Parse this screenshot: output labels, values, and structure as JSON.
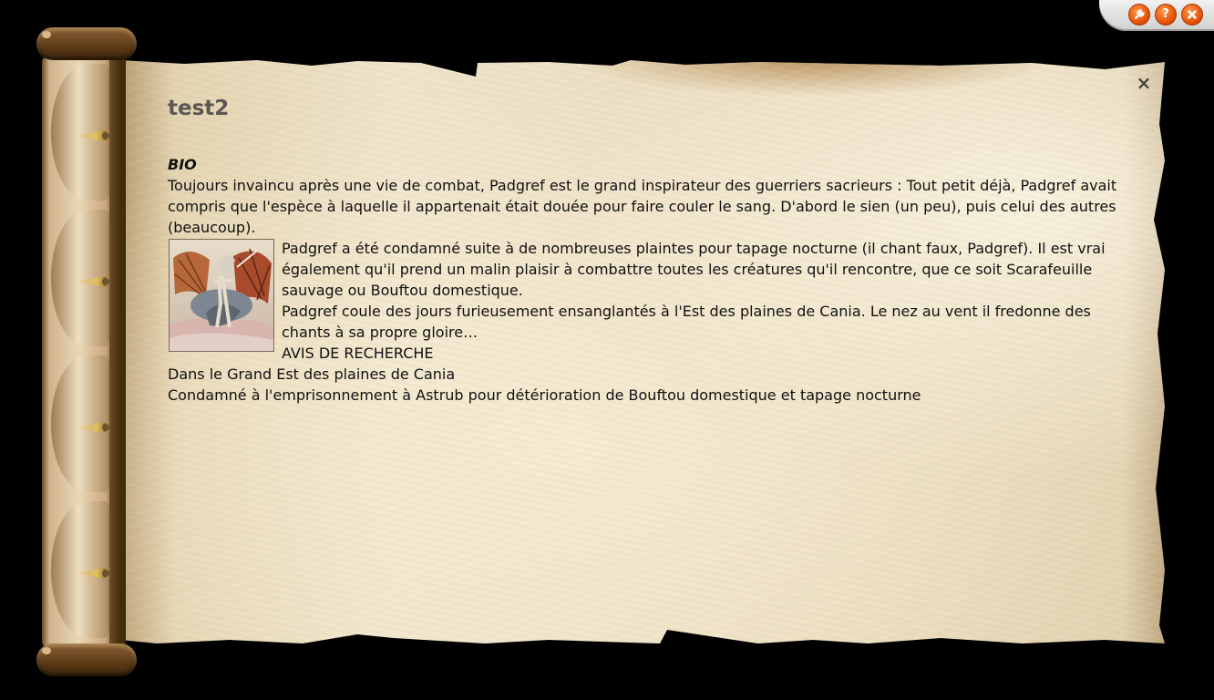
{
  "window": {
    "controls": [
      {
        "icon": "wrench-icon"
      },
      {
        "icon": "help-icon",
        "glyph": "?"
      },
      {
        "icon": "close-icon"
      }
    ],
    "close_glyph": "×"
  },
  "profile": {
    "name": "test2",
    "bio_heading": "BIO",
    "bio_intro": "Toujours invaincu après une vie de combat, Padgref est le grand inspirateur des guerriers sacrieurs : Tout petit déjà, Padgref avait compris que l'espèce à laquelle il appartenait était douée pour faire couler le sang. D'abord le sien (un peu), puis celui des autres (beaucoup).",
    "bio_paragraph_2": "Padgref a été condamné suite à de nombreuses plaintes pour tapage nocturne (il chant faux, Padgref). Il est vrai également qu'il prend un malin plaisir à combattre toutes les créatures qu'il rencontre, que ce soit Scarafeuille sauvage ou Bouftou domestique.",
    "bio_paragraph_3": "Padgref coule des jours furieusement ensanglantés à l'Est des plaines de Cania. Le nez au vent il fredonne des chants à sa propre gloire…",
    "wanted_heading": "AVIS DE RECHERCHE",
    "wanted_location": "Dans le Grand Est des plaines de Cania",
    "wanted_reason": "Condamné à l'emprisonnement à Astrub pour détérioration de Bouftou domestique et tapage nocturne",
    "portrait_subject": "dragon-warrior-illustration"
  },
  "colors": {
    "control_button": "#e04a00",
    "title_text": "#5a5752",
    "body_text": "#111111",
    "parchment": "#efe4cb",
    "rod_wood": "#5c3a17"
  }
}
